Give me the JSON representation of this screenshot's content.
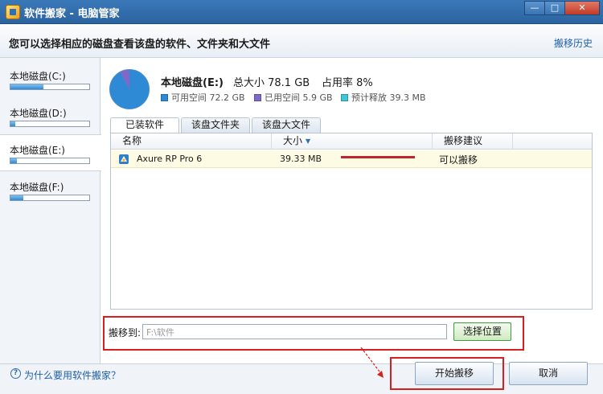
{
  "window": {
    "title": "软件搬家 - 电脑管家",
    "min_label": "—",
    "max_label": "□",
    "close_label": "✕"
  },
  "header": {
    "instruction": "您可以选择相应的磁盘查看该盘的软件、文件夹和大文件",
    "history_link": "搬移历史"
  },
  "sidebar": {
    "disks": [
      {
        "label": "本地磁盘(C:)",
        "usage_fraction": 0.42
      },
      {
        "label": "本地磁盘(D:)",
        "usage_fraction": 0.06
      },
      {
        "label": "本地磁盘(E:)",
        "usage_fraction": 0.08
      },
      {
        "label": "本地磁盘(F:)",
        "usage_fraction": 0.16
      }
    ],
    "selected_index": 2
  },
  "disk_info": {
    "name": "本地磁盘(E:)",
    "total": "总大小 78.1 GB",
    "usage": "占用率 8%",
    "usage_percent": 8,
    "legend": [
      {
        "label": "可用空间 72.2 GB",
        "color": "#2f8ad6"
      },
      {
        "label": "已用空间 5.9 GB",
        "color": "#8068c8"
      },
      {
        "label": "预计释放 39.3 MB",
        "color": "#3cc6d8"
      }
    ]
  },
  "tabs": [
    "已装软件",
    "该盘文件夹",
    "该盘大文件"
  ],
  "active_tab": 0,
  "table": {
    "columns": [
      "名称",
      "大小",
      "搬移建议"
    ],
    "rows": [
      {
        "name": "Axure RP Pro 6",
        "size": "39.33 MB",
        "advice": "可以搬移"
      }
    ]
  },
  "move": {
    "label": "搬移到:",
    "value": "F:\\软件",
    "choose_button": "选择位置"
  },
  "footer": {
    "help_icon": "?",
    "help_link": "为什么要用软件搬家？",
    "start_button": "开始搬移",
    "cancel_button": "取消"
  },
  "colors": {
    "titlebar": "#2c64a0",
    "highlight_border": "#d81e1e",
    "link": "#1f5fa8"
  }
}
